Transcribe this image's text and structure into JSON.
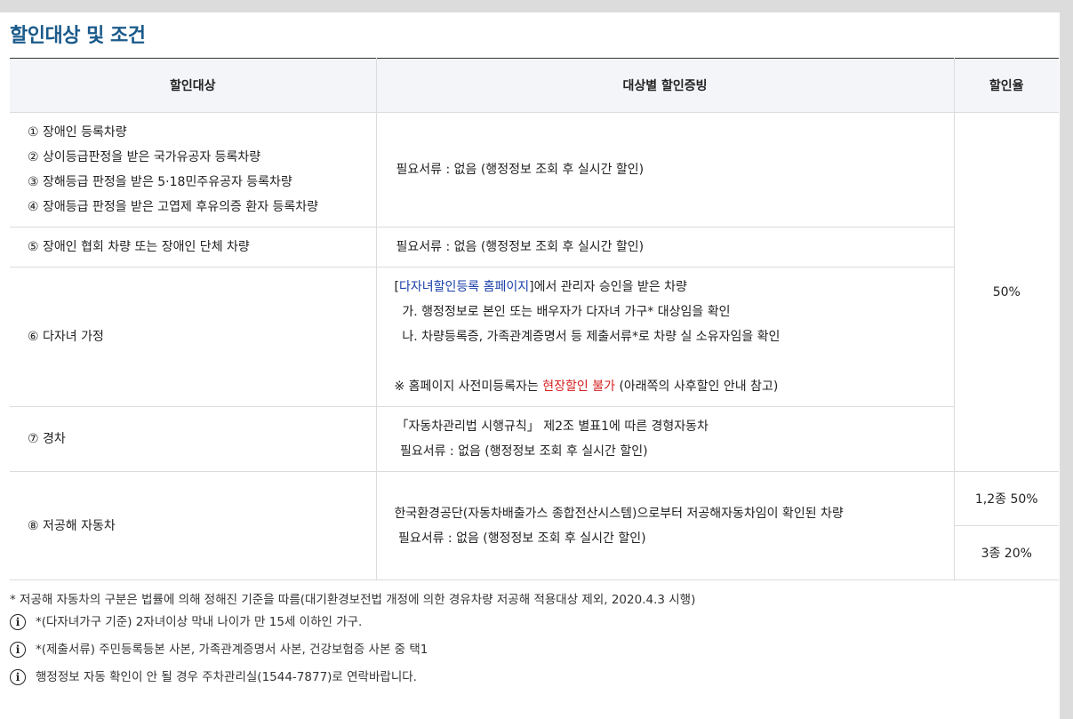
{
  "title": "할인대상 및 조건",
  "table": {
    "headers": [
      "할인대상",
      "대상별 할인증빙",
      "할인율"
    ],
    "rows": [
      {
        "target_lines": [
          "① 장애인 등록차량",
          "② 상이등급판정을 받은 국가유공자 등록차량",
          "③ 장해등급 판정을 받은 5·18민주유공자 등록차량",
          "④ 장애등급 판정을 받은 고엽제 후유의증 환자 등록차량"
        ],
        "proof_lines": [
          "필요서류 : 없음 (행정정보 조회 후 실시간 할인)"
        ]
      },
      {
        "target_lines": [
          "⑤ 장애인 협회 차량 또는 장애인 단체 차량"
        ],
        "proof_lines": [
          "필요서류 : 없음 (행정정보 조회 후 실시간 할인)"
        ]
      },
      {
        "target_lines": [
          "⑥ 다자녀 가정"
        ],
        "proof": {
          "link_text": "다자녀할인등록 홈페이지",
          "line1_prefix": "[",
          "line1_suffix": "]에서 관리자 승인을 받은 차량",
          "line2": "  가. 행정정보로 본인 또는 배우자가 다자녀 가구* 대상임을 확인",
          "line3": "  나. 차량등록증, 가족관계증명서 등 제출서류*로 차량 실 소유자임을 확인",
          "note_prefix": "※ 홈페이지 사전미등록자는 ",
          "note_red": "현장할인 불가",
          "note_suffix": " (아래쪽의 사후할인 안내 참고)"
        }
      },
      {
        "target_lines": [
          "⑦ 경차"
        ],
        "proof_lines": [
          "「자동차관리법 시행규칙」 제2조 별표1에 따른 경형자동차",
          " 필요서류 : 없음 (행정정보 조회 후 실시간 할인)"
        ]
      },
      {
        "target_lines": [
          "⑧ 저공해 자동차"
        ],
        "proof_lines": [
          "한국환경공단(자동차배출가스 종합전산시스템)으로부터 저공해자동차임이 확인된 차량",
          " 필요서류 : 없음 (행정정보 조회 후 실시간 할인)"
        ]
      }
    ],
    "rates": {
      "general": "50%",
      "low_emission_12": "1,2종 50%",
      "low_emission_3": "3종 20%"
    }
  },
  "footnote": "* 저공해 자동차의 구분은 법률에 의해 정해진 기준을 따름(대기환경보전법 개정에 의한 경유차량 저공해 적용대상 제외, 2020.4.3 시행)",
  "info_notes": [
    "*(다자녀가구 기준) 2자녀이상 막내 나이가 만 15세 이하인 가구.",
    "*(제출서류) 주민등록등본 사본, 가족관계증명서 사본, 건강보험증 사본 중 택1",
    "행정정보 자동 확인이 안 될 경우 주차관리실(1544-7877)로 연락바랍니다."
  ],
  "icons": {
    "info": "info-circle-icon"
  },
  "colors": {
    "title": "#1a5a8a",
    "link": "#1a3fa8",
    "warning": "#d41e1e",
    "header_bg": "#f4f5f9"
  }
}
